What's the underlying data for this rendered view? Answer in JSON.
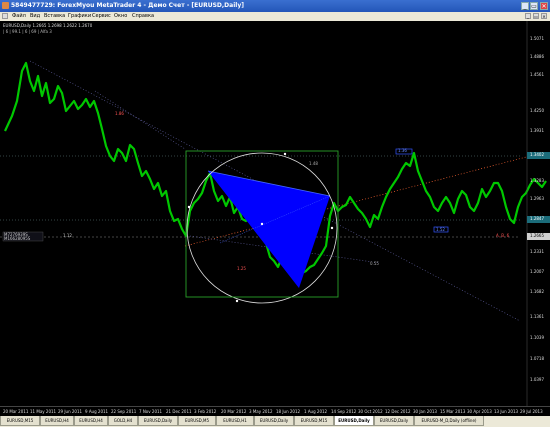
{
  "window": {
    "title": "5849477729: ForexMyou MetaTrader 4 - Демо Счет - [EURUSD,Daily]",
    "controls": [
      "_",
      "▭",
      "✕"
    ]
  },
  "menu": {
    "items": [
      "Файл",
      "Вид",
      "Вставка",
      "Графики",
      "Сервис",
      "Окно",
      "Справка"
    ],
    "doc_controls": [
      "_",
      "▭",
      "✕"
    ]
  },
  "chart": {
    "symbol_line": "EURUSD,Daily  1.2665 1.2698 1.2622 1.2670",
    "info_line": "| 6 | 99.1 | 6 | 69 | Alfa 3",
    "overlay_labels": [
      "1.12",
      "1.25",
      "1.48",
      "1.86",
      "1.36",
      "0.55",
      "1.52"
    ],
    "left_box_labels": [
      "M7276939S",
      "M16628095S"
    ],
    "right_label": "A, B, 6",
    "price_scale": [
      "1.5071",
      "1.4886",
      "1.4561",
      "1.4250",
      "1.3931",
      "1.3602",
      "1.3283",
      "1.2963",
      "1.2653",
      "1.2331",
      "1.2007",
      "1.1682",
      "1.1361",
      "1.1039",
      "1.0718",
      "1.0397"
    ],
    "current_price": "1.2665",
    "level_upper": "1.3402",
    "level_lower": "1.2847",
    "colors": {
      "candles": "#00c800",
      "triangle": "#0000ff",
      "box": "#2aa02a",
      "fib_line": "#ff6633"
    }
  },
  "date_axis": [
    "20 Mar 2011",
    "11 May 2011",
    "29 Jun 2011",
    "9 Aug 2011",
    "22 Sep 2011",
    "7 Nov 2011",
    "21 Dec 2011",
    "3 Feb 2012",
    "20 Mar 2012",
    "3 May 2012",
    "18 Jun 2012",
    "1 Aug 2012",
    "14 Sep 2012",
    "30 Oct 2012",
    "12 Dec 2012",
    "30 Jan 2013",
    "15 Mar 2013",
    "30 Apr 2013",
    "13 Jun 2013",
    "29 Jul 2013"
  ],
  "tabs": [
    "EURUSD,M15",
    "EURUSD,H4",
    "EURUSD,H4",
    "GOLD,H4",
    "EURUSD,Daily",
    "EURUSD,M5",
    "EURUSD,H1",
    "EURUSD,Daily",
    "EURUSD,M15",
    "EURUSD,Daily",
    "EURUSD,Daily",
    "EURUSD-M_D,Daily (offline)"
  ],
  "active_tab_index": 9
}
